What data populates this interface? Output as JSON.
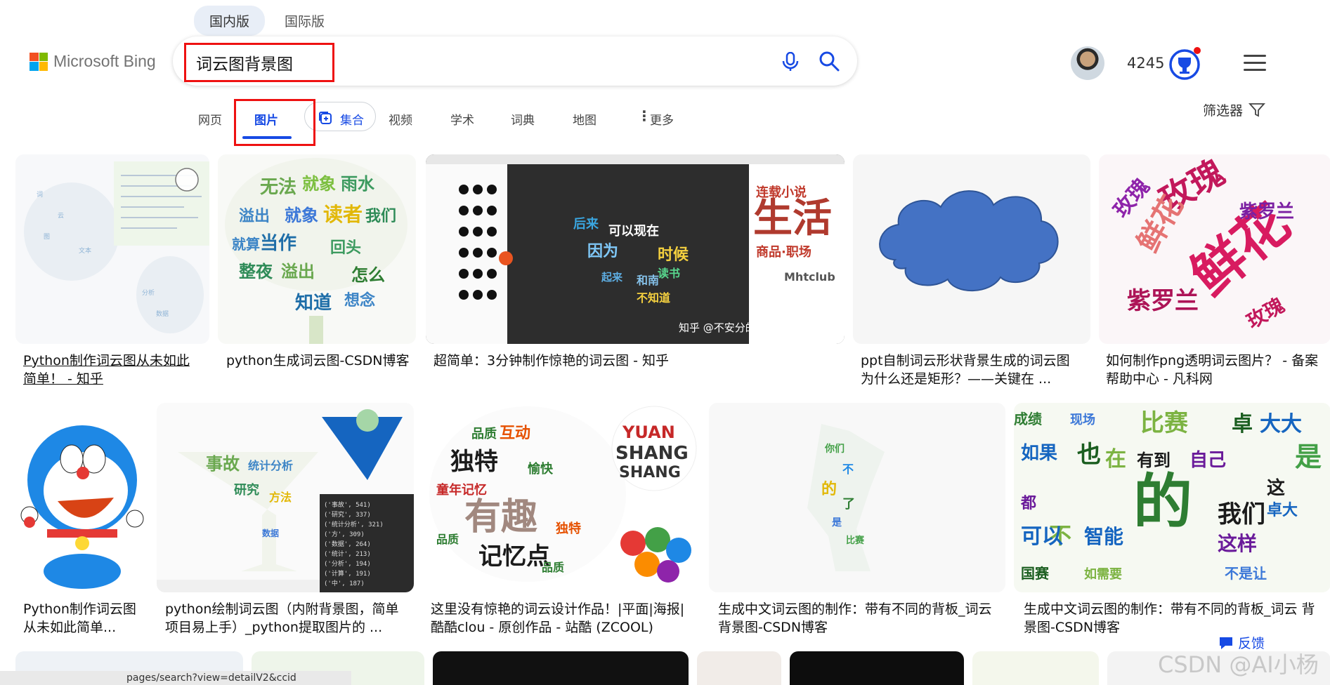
{
  "market_tabs": [
    "国内版",
    "国际版"
  ],
  "logo": {
    "text": "Microsoft Bing",
    "colors": [
      "#f25022",
      "#7fba00",
      "#00a4ef",
      "#ffb900"
    ]
  },
  "search": {
    "query": "词云图背景图"
  },
  "header": {
    "points": "4245"
  },
  "nav": {
    "items": [
      {
        "label": "网页"
      },
      {
        "label": "图片"
      },
      {
        "label": "集合"
      },
      {
        "label": "视频"
      },
      {
        "label": "学术"
      },
      {
        "label": "词典"
      },
      {
        "label": "地图"
      },
      {
        "label": "更多"
      }
    ],
    "filter_label": "筛选器"
  },
  "results": [
    {
      "caption": "Python制作词云图从未如此简单！ - 知乎"
    },
    {
      "caption": "python生成词云图-CSDN博客"
    },
    {
      "caption": "超简单：3分钟制作惊艳的词云图 - 知乎",
      "overlay": "知乎 @不安分的"
    },
    {
      "caption": "ppt自制词云形状背景生成的词云图为什么还是矩形？——关键在 ..."
    },
    {
      "caption": "如何制作png透明词云图片？ - 备案帮助中心 - 凡科网"
    },
    {
      "caption": "Python制作词云图从未如此简单..."
    },
    {
      "caption": "python绘制词云图（内附背景图，简单项目易上手）_python提取图片的 ..."
    },
    {
      "caption": "这里没有惊艳的词云设计作品！|平面|海报|酷酷clou - 原创作品 - 站酷 (ZCOOL)"
    },
    {
      "caption": "生成中文词云图的制作：带有不同的背板_词云背景图-CSDN博客"
    },
    {
      "caption": "生成中文词云图的制作：带有不同的背板_词云 背景图-CSDN博客"
    }
  ],
  "feedback_label": "反馈",
  "status_url": "pages/search?view=detailV2&ccid",
  "watermark": "CSDN @AI小杨",
  "accent": "#174ae4",
  "highlight": "#e11111"
}
